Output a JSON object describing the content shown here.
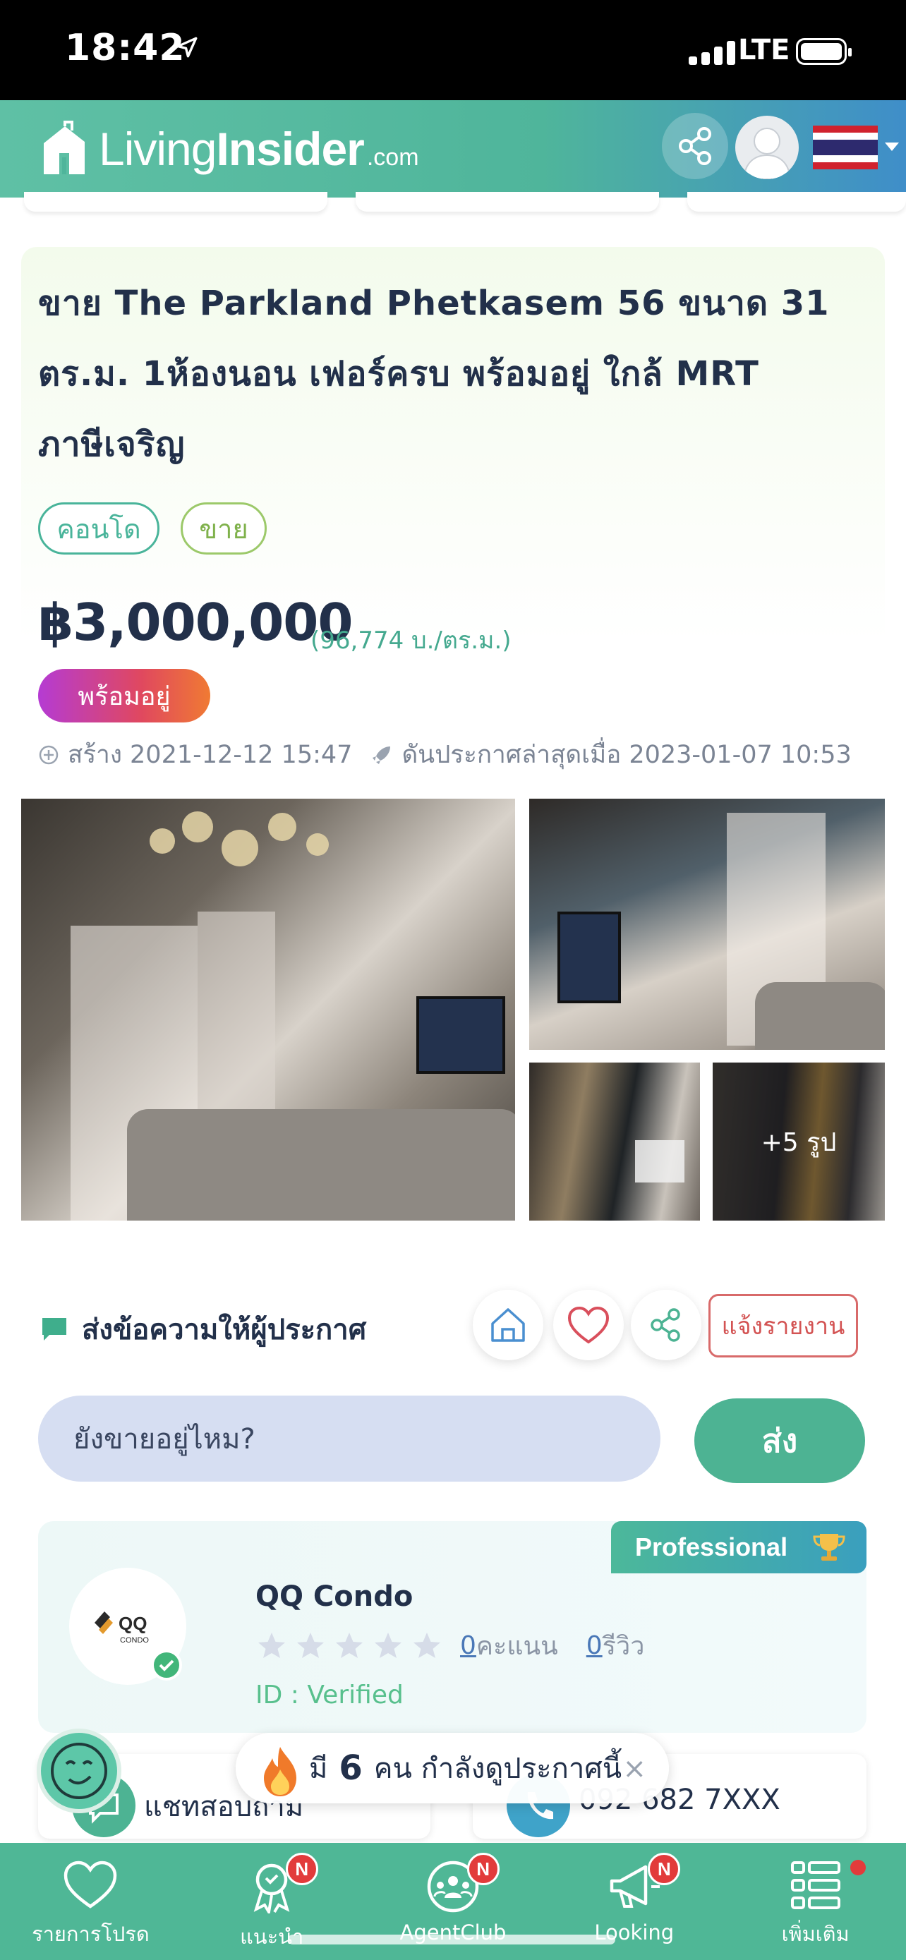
{
  "status_bar": {
    "time": "18:42",
    "network": "LTE"
  },
  "header": {
    "logo_light": "Living",
    "logo_bold": "Insider",
    "logo_suffix": ".com"
  },
  "listing": {
    "title": "ขาย The Parkland Phetkasem 56 ขนาด 31 ตร.ม. 1ห้องนอน เฟอร์ครบ พร้อมอยู่ ใกล้ MRT ภาษีเจริญ",
    "tags": [
      "คอนโด",
      "ขาย"
    ],
    "price": "฿3,000,000",
    "price_per_area": "(96,774 บ./ตร.ม.)",
    "ready_badge": "พร้อมอยู่",
    "created": "สร้าง 2021-12-12 15:47",
    "bumped": "ดันประกาศล่าสุดเมื่อ 2023-01-07 10:53",
    "more_photos": "+5 รูป"
  },
  "message": {
    "title": "ส่งข้อความให้ผู้ประกาศ",
    "report_label": "แจ้งรายงาน",
    "input_value": "ยังขายอยู่ไหม?",
    "send_label": "ส่ง"
  },
  "agent": {
    "badge": "Professional",
    "logo_text": "QQ",
    "logo_sub": "CONDO",
    "name": "QQ Condo",
    "rating_stars": 0,
    "score_count": "0",
    "score_label": "คะแนน",
    "review_count": "0",
    "review_label": "รีวิว",
    "id_status": "ID : Verified"
  },
  "contacts": {
    "chat_label": "แชทสอบถาม",
    "phone": "092 682 7XXX"
  },
  "viewers": {
    "prefix": "มี",
    "count": "6",
    "suffix": "คน กำลังดูประกาศนี้",
    "close": "×"
  },
  "bottom_nav": {
    "items": [
      {
        "label": "รายการโปรด",
        "badge": ""
      },
      {
        "label": "แนะนำ",
        "badge": "N"
      },
      {
        "label": "AgentClub",
        "badge": "N"
      },
      {
        "label": "Looking",
        "badge": "N"
      },
      {
        "label": "เพิ่มเติม",
        "badge": ""
      }
    ]
  },
  "colors": {
    "brand_green": "#4fb796",
    "brand_blue": "#3f8ec9",
    "report_red": "#d35353",
    "badge_red": "#e23b3b"
  }
}
